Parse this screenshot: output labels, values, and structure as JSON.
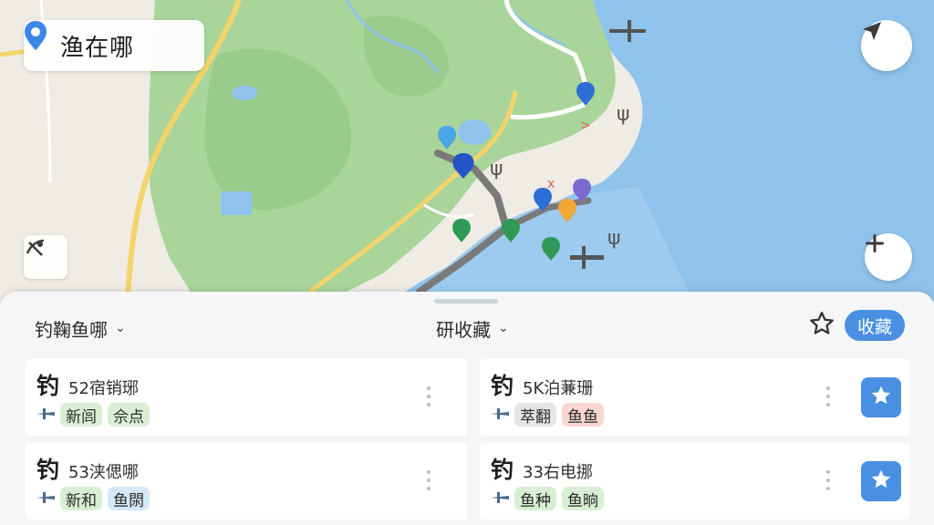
{
  "app": {
    "title": "渔在哪"
  },
  "map": {
    "controls": {
      "location_icon": "location-pin-icon",
      "navigate_icon": "navigation-arrow-icon",
      "zoom_in_icon": "plus-icon",
      "layers_icon": "no-fishing-icon"
    },
    "colors": {
      "water": "#8fc3ec",
      "land": "#a9d49a",
      "road": "#f3d46a",
      "route": "#7a7a7a"
    }
  },
  "sheet": {
    "filter_left": "钓鞠鱼哪",
    "filter_mid": "研收藏",
    "favorite_label": "收藏",
    "rows": [
      {
        "left": {
          "icon_char": "钓",
          "label": "52宿销琊",
          "tags": [
            {
              "text": "新闾",
              "color": "green"
            },
            {
              "text": "佘点",
              "color": "green"
            }
          ]
        },
        "right": {
          "icon_char": "钓",
          "label": "5K泊蒹珊",
          "tags": [
            {
              "text": "萃翻",
              "color": "gray"
            },
            {
              "text": "鱼鱼",
              "color": "red"
            }
          ]
        }
      },
      {
        "left": {
          "icon_char": "钓",
          "label": "53浃偲哪",
          "tags": [
            {
              "text": "新和",
              "color": "green"
            },
            {
              "text": "鱼閖",
              "color": "blue"
            }
          ]
        },
        "right": {
          "icon_char": "钓",
          "label": "33右电挪",
          "tags": [
            {
              "text": "鱼种",
              "color": "green"
            },
            {
              "text": "鱼晌",
              "color": "green"
            }
          ]
        }
      }
    ]
  }
}
